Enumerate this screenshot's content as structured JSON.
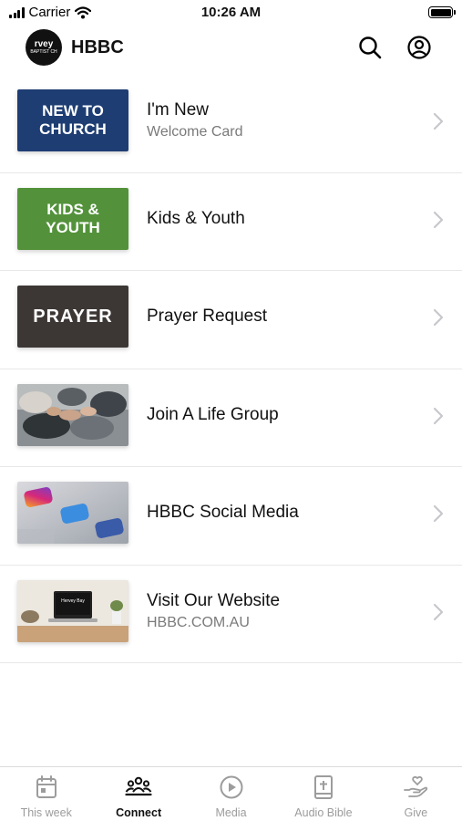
{
  "status_bar": {
    "carrier": "Carrier",
    "time": "10:26 AM"
  },
  "header": {
    "logo_text": "rvey",
    "logo_subtext": "BAPTIST CH",
    "title": "HBBC",
    "search_icon": "search-icon",
    "profile_icon": "profile-icon"
  },
  "items": [
    {
      "title": "I'm New",
      "subtitle": "Welcome Card",
      "thumb_line1": "NEW TO",
      "thumb_line2": "CHURCH",
      "thumb_color": "#1e3d73"
    },
    {
      "title": "Kids & Youth",
      "subtitle": "",
      "thumb_line1": "KIDS &",
      "thumb_line2": "YOUTH",
      "thumb_color": "#53923b"
    },
    {
      "title": "Prayer Request",
      "subtitle": "",
      "thumb_line1": "PRAYER",
      "thumb_color": "#3c3735"
    },
    {
      "title": "Join A Life Group",
      "subtitle": ""
    },
    {
      "title": "HBBC Social Media",
      "subtitle": ""
    },
    {
      "title": "Visit Our Website",
      "subtitle": "HBBC.COM.AU",
      "thumb_screen_text": "Hervey Bay"
    }
  ],
  "tabs": [
    {
      "label": "This week",
      "icon": "calendar-icon",
      "active": false
    },
    {
      "label": "Connect",
      "icon": "people-icon",
      "active": true
    },
    {
      "label": "Media",
      "icon": "play-icon",
      "active": false
    },
    {
      "label": "Audio Bible",
      "icon": "bible-icon",
      "active": false
    },
    {
      "label": "Give",
      "icon": "give-icon",
      "active": false
    }
  ],
  "colors": {
    "accent": "#111111",
    "inactive_tab": "#9c9c9c",
    "subtitle": "#7a7a7a"
  }
}
